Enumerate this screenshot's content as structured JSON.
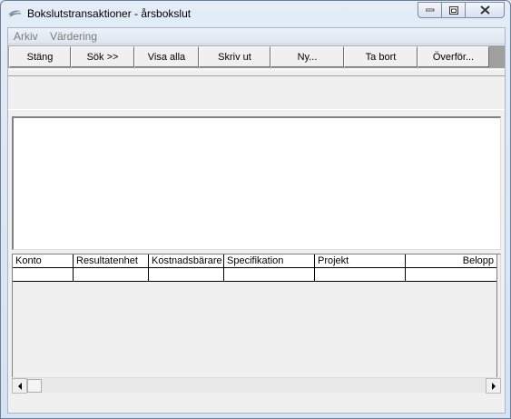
{
  "window": {
    "title": "Bokslutstransaktioner - årsbokslut",
    "icon": "app-icon"
  },
  "menu": {
    "items": [
      "Arkiv",
      "Värdering"
    ]
  },
  "toolbar": {
    "buttons": [
      "Stäng",
      "Sök >>",
      "Visa alla",
      "Skriv ut",
      "Ny...",
      "Ta bort",
      "Överför..."
    ]
  },
  "grid": {
    "columns": [
      "Konto",
      "Resultatenhet",
      "Kostnadsbärare",
      "Specifikation",
      "Projekt",
      "Belopp"
    ]
  },
  "colors": {
    "title_bar": "#dfe9f5",
    "client_background": "#f0f0f0",
    "toolbar_background": "#a0a0a0",
    "menu_disabled_text": "#7b7b7b"
  }
}
